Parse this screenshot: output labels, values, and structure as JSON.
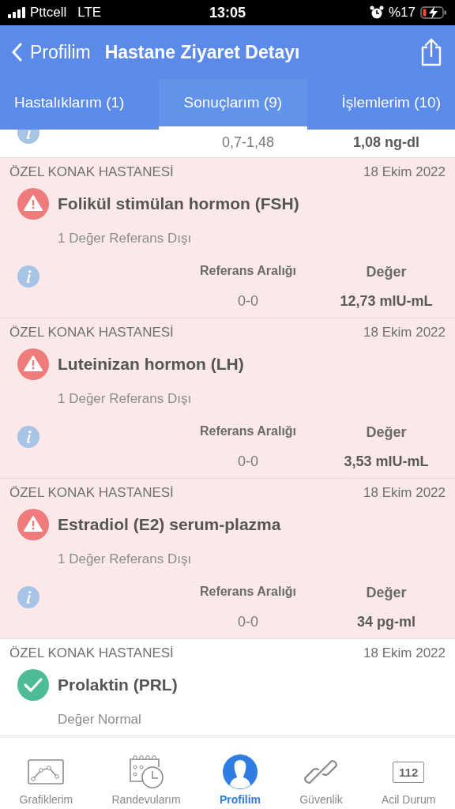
{
  "status_bar": {
    "carrier": "Pttcell",
    "network": "LTE",
    "time": "13:05",
    "battery": "%17"
  },
  "nav": {
    "back": "Profilim",
    "title": "Hastane Ziyaret Detayı"
  },
  "tabs": [
    {
      "label": "Hastalıklarım (1)",
      "selected": false
    },
    {
      "label": "Sonuçlarım (9)",
      "selected": true
    },
    {
      "label": "İşlemlerim (10)",
      "selected": false
    }
  ],
  "results": [
    {
      "kind": "normal",
      "reference": "0,7-1,48",
      "value": "1,08 ng-dl"
    },
    {
      "kind": "abnormal",
      "hospital": "ÖZEL KONAK HASTANESİ",
      "date": "18 Ekim 2022",
      "test": "Folikül stimülan hormon (FSH)",
      "status": "1 Değer Referans Dışı",
      "reference_header": "Referans Aralığı",
      "value_header": "Değer",
      "reference": "0-0",
      "value": "12,73 mIU-mL"
    },
    {
      "kind": "abnormal",
      "hospital": "ÖZEL KONAK HASTANESİ",
      "date": "18 Ekim 2022",
      "test": "Luteinizan hormon (LH)",
      "status": "1 Değer Referans Dışı",
      "reference_header": "Referans Aralığı",
      "value_header": "Değer",
      "reference": "0-0",
      "value": "3,53 mIU-mL"
    },
    {
      "kind": "abnormal",
      "hospital": "ÖZEL KONAK HASTANESİ",
      "date": "18 Ekim 2022",
      "test": "Estradiol (E2) serum-plazma",
      "status": "1 Değer Referans Dışı",
      "reference_header": "Referans Aralığı",
      "value_header": "Değer",
      "reference": "0-0",
      "value": "34 pg-ml"
    },
    {
      "kind": "normal",
      "hospital": "ÖZEL KONAK HASTANESİ",
      "date": "18 Ekim 2022",
      "test": "Prolaktin (PRL)",
      "status": "Değer Normal"
    }
  ],
  "bottom_tabs": [
    {
      "kind": "chart",
      "label": "Grafiklerim",
      "selected": false
    },
    {
      "kind": "calendar",
      "label": "Randevularım",
      "selected": false
    },
    {
      "kind": "person",
      "label": "Profilim",
      "selected": true
    },
    {
      "kind": "link",
      "label": "Güvenlik",
      "selected": false
    },
    {
      "kind": "emergency",
      "label": "Acil Durum",
      "icon_text": "112",
      "selected": false
    }
  ]
}
